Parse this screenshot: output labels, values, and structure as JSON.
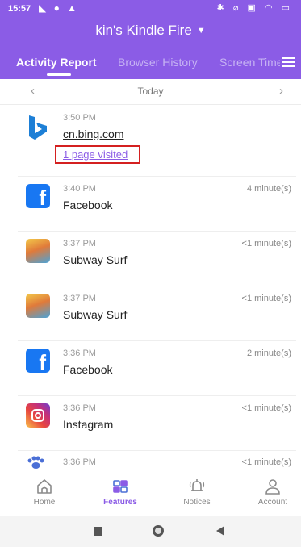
{
  "status_bar": {
    "time": "15:57",
    "left_icons": "◣ ● ▲",
    "right_icons": "✱ ⌀ ▣ ◠ ▭"
  },
  "header": {
    "device_title": "kin's Kindle Fire",
    "dropdown_glyph": "▼",
    "tabs": [
      {
        "label": "Activity Report"
      },
      {
        "label": "Browser History"
      },
      {
        "label": "Screen Time"
      }
    ]
  },
  "date_nav": {
    "prev": "‹",
    "label": "Today",
    "next": "›"
  },
  "activities": [
    {
      "time": "3:50 PM",
      "app": "cn.bing.com",
      "detail_link": "1 page visited",
      "duration": "",
      "icon": "bing-icon"
    },
    {
      "time": "3:40 PM",
      "app": "Facebook",
      "duration": "4 minute(s)",
      "icon": "facebook-icon"
    },
    {
      "time": "3:37 PM",
      "app": "Subway Surf",
      "duration": "<1 minute(s)",
      "icon": "subway-surf-icon"
    },
    {
      "time": "3:37 PM",
      "app": "Subway Surf",
      "duration": "<1 minute(s)",
      "icon": "subway-surf-icon"
    },
    {
      "time": "3:36 PM",
      "app": "Facebook",
      "duration": "2 minute(s)",
      "icon": "facebook-icon"
    },
    {
      "time": "3:36 PM",
      "app": "Instagram",
      "duration": "<1 minute(s)",
      "icon": "instagram-icon"
    },
    {
      "time": "3:36 PM",
      "app": "",
      "duration": "<1 minute(s)",
      "icon": "paw-app-icon"
    }
  ],
  "bottom_nav": {
    "items": [
      {
        "label": "Home",
        "icon": "home-icon"
      },
      {
        "label": "Features",
        "icon": "features-grid-icon"
      },
      {
        "label": "Notices",
        "icon": "bell-icon"
      },
      {
        "label": "Account",
        "icon": "person-icon"
      }
    ]
  },
  "colors": {
    "brand_purple": "#8b5ce6",
    "highlight_red": "#d42020",
    "facebook_blue": "#1877f2",
    "bing_blue": "#1d7fd6"
  }
}
